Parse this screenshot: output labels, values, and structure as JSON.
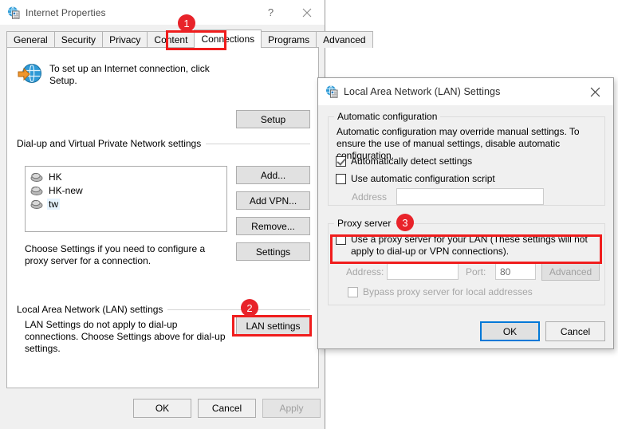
{
  "ie_properties": {
    "title": "Internet Properties",
    "title_icon": "internet-properties-icon",
    "help_button": "?",
    "close_button": "✕",
    "tabs": [
      {
        "label": "General",
        "selected": false
      },
      {
        "label": "Security",
        "selected": false
      },
      {
        "label": "Privacy",
        "selected": false
      },
      {
        "label": "Content",
        "selected": false
      },
      {
        "label": "Connections",
        "selected": true
      },
      {
        "label": "Programs",
        "selected": false
      },
      {
        "label": "Advanced",
        "selected": false
      }
    ],
    "setup_text": "To set up an Internet connection, click Setup.",
    "setup_button": "Setup",
    "dialup_group_label": "Dial-up and Virtual Private Network settings",
    "connections": [
      {
        "name": "HK",
        "selected": false
      },
      {
        "name": "HK-new",
        "selected": false
      },
      {
        "name": "tw",
        "selected": true
      }
    ],
    "add_button": "Add...",
    "add_vpn_button": "Add VPN...",
    "remove_button": "Remove...",
    "settings_button": "Settings",
    "proxy_hint": "Choose Settings if you need to configure a proxy server for a connection.",
    "lan_group_label": "Local Area Network (LAN) settings",
    "lan_hint": "LAN Settings do not apply to dial-up connections. Choose Settings above for dial-up settings.",
    "lan_settings_button": "LAN settings",
    "ok_button": "OK",
    "cancel_button": "Cancel",
    "apply_button": "Apply"
  },
  "lan_dialog": {
    "title": "Local Area Network (LAN) Settings",
    "title_icon": "internet-properties-icon",
    "close_button": "✕",
    "auto_config": {
      "group_label": "Automatic configuration",
      "description": "Automatic configuration may override manual settings.  To ensure the use of manual settings, disable automatic configuration.",
      "auto_detect_label": "Automatically detect settings",
      "auto_detect_checked": true,
      "use_script_label": "Use automatic configuration script",
      "use_script_checked": false,
      "address_label": "Address",
      "address_value": ""
    },
    "proxy": {
      "group_label": "Proxy server",
      "use_proxy_label": "Use a proxy server for your LAN (These settings will not apply to dial-up or VPN connections).",
      "use_proxy_checked": false,
      "address_label": "Address:",
      "address_value": "",
      "port_label": "Port:",
      "port_value": "80",
      "advanced_button": "Advanced",
      "bypass_label": "Bypass proxy server for local addresses",
      "bypass_checked": false
    },
    "ok_button": "OK",
    "cancel_button": "Cancel"
  },
  "annotations": {
    "badges": [
      {
        "number": "1",
        "target": "connections-tab"
      },
      {
        "number": "2",
        "target": "lan-settings-button"
      },
      {
        "number": "3",
        "target": "use-proxy-checkbox"
      }
    ],
    "highlight_color": "#f01d1d"
  }
}
